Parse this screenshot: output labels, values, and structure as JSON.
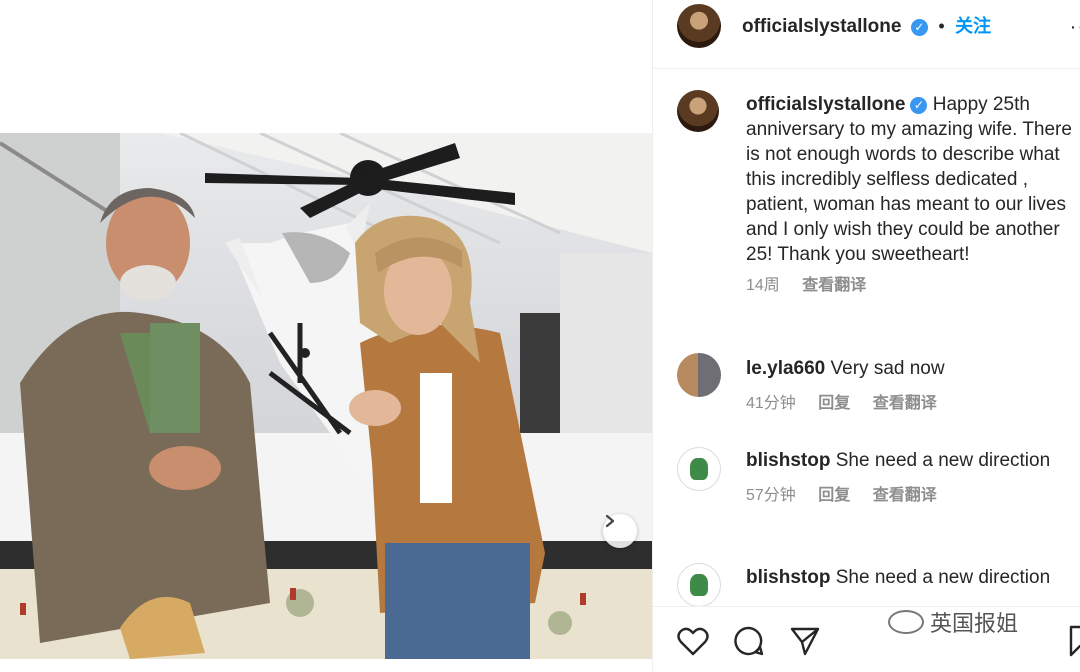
{
  "header": {
    "username": "officialslystallone",
    "separator": "•",
    "follow_label": "关注",
    "more_label": "··"
  },
  "caption": {
    "username": "officialslystallone",
    "text": "Happy 25th anniversary to my amazing wife. There is not enough words to describe what this incredibly selfless dedicated , patient, woman has meant to our lives and I only wish they could be another 25! Thank you sweetheart!",
    "time": "14周",
    "translate": "查看翻译"
  },
  "comments": [
    {
      "username": "le.yla660",
      "text": "Very sad now",
      "time": "41分钟",
      "reply": "回复",
      "translate": "查看翻译"
    },
    {
      "username": "blishstop",
      "text": "She need a new direction",
      "time": "57分钟",
      "reply": "回复",
      "translate": "查看翻译"
    },
    {
      "username": "blishstop",
      "text": "She need a new direction"
    }
  ],
  "watermark": {
    "text": "英国报姐"
  },
  "icons": {
    "like": "heart-icon",
    "comment": "comment-icon",
    "share": "share-icon",
    "save": "bookmark-icon",
    "next": "chevron-right-icon",
    "verified": "verified-badge-icon"
  },
  "colors": {
    "accent": "#0095f6",
    "verified": "#3897f0",
    "muted": "#8e8e8e"
  }
}
